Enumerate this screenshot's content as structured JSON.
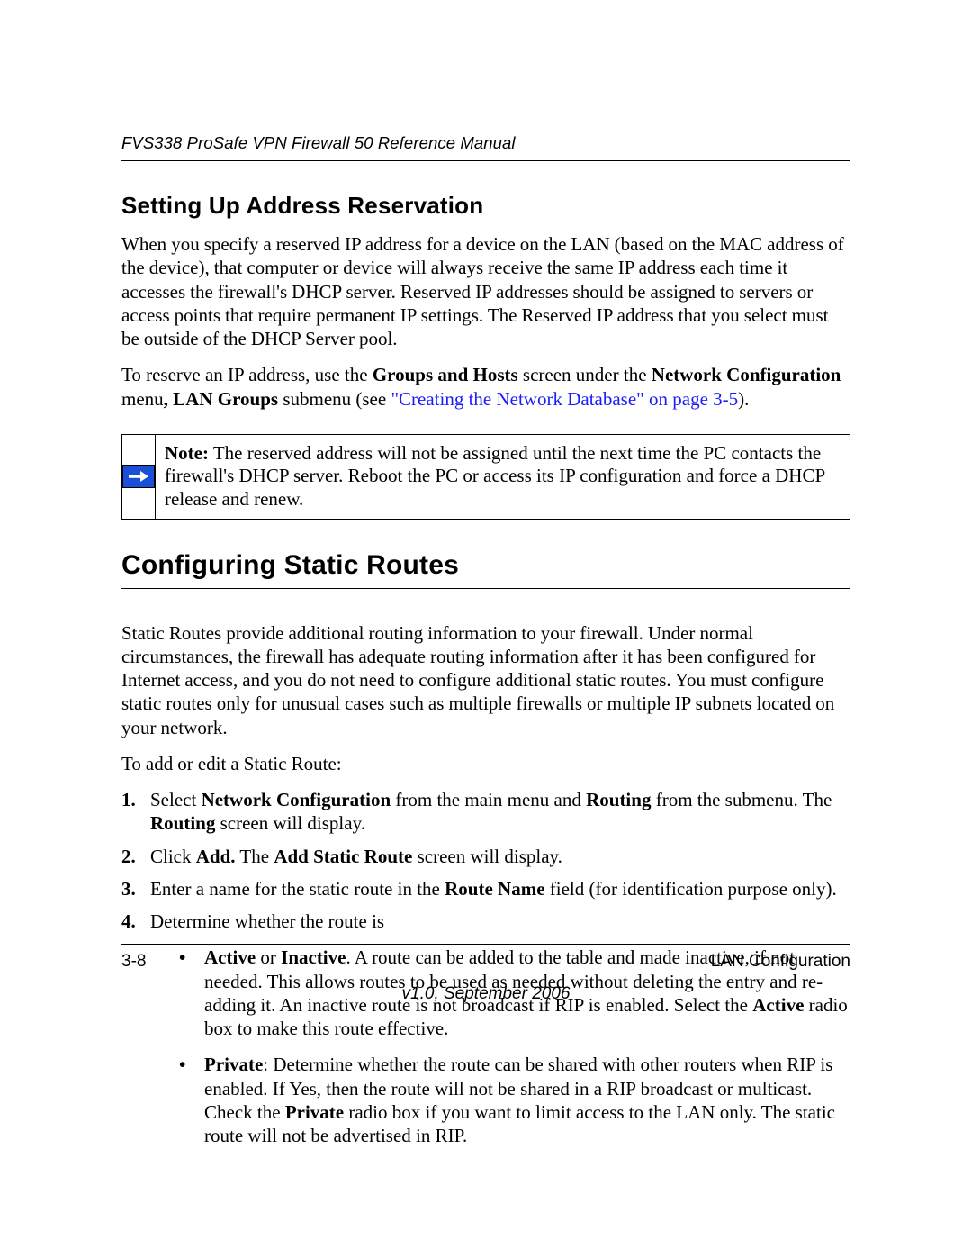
{
  "runningHead": "FVS338 ProSafe VPN Firewall 50 Reference Manual",
  "section1": {
    "title": "Setting Up Address Reservation",
    "p1": "When you specify a reserved IP address for a device on the LAN (based on the MAC address of the device), that computer or device will always receive the same IP address each time it accesses the firewall's DHCP server. Reserved IP addresses should be assigned to servers or access points that require permanent IP settings. The Reserved IP address that you select must be outside of the DHCP Server pool.",
    "p2_a": "To reserve an IP address, use the ",
    "p2_b": "Groups and Hosts",
    "p2_c": " screen under the ",
    "p2_d": "Network Configuration",
    "p2_e": " menu",
    "p2_f": ", LAN Groups",
    "p2_g": " submenu (see ",
    "p2_link": "\"Creating the Network Database\" on page 3-5",
    "p2_h": ")."
  },
  "note": {
    "label": "Note:",
    "text": " The reserved address will not be assigned until the next time the PC contacts the firewall's DHCP server. Reboot the PC or access its IP configuration and force a DHCP release and renew."
  },
  "section2": {
    "title": "Configuring Static Routes",
    "p1": "Static Routes provide additional routing information to your firewall. Under normal circumstances, the firewall has adequate routing information after it has been configured for Internet access, and you do not need to configure additional static routes. You must configure static routes only for unusual cases such as multiple firewalls or multiple IP subnets located on your network.",
    "p2": "To add or edit a Static Route:"
  },
  "steps": {
    "s1_a": "Select ",
    "s1_b": "Network Configuration",
    "s1_c": " from the main menu and ",
    "s1_d": "Routing",
    "s1_e": " from the submenu. The ",
    "s1_f": "Routing",
    "s1_g": " screen will display.",
    "s2_a": "Click ",
    "s2_b": "Add.",
    "s2_c": " The ",
    "s2_d": "Add Static Route",
    "s2_e": " screen will display.",
    "s3_a": "Enter a name for the static route in the ",
    "s3_b": "Route Name",
    "s3_c": " field (for identification purpose only).",
    "s4": "Determine whether the route is"
  },
  "bullets": {
    "b1_a": "Active",
    "b1_b": " or ",
    "b1_c": "Inactive",
    "b1_d": ". A route can be added to the table and made inactive, if not needed. This allows routes to be used as needed without deleting the entry and re-adding it. An inactive route is not broadcast if RIP is enabled. Select the ",
    "b1_e": "Active",
    "b1_f": " radio box to make this route effective.",
    "b2_a": "Private",
    "b2_b": ": Determine whether the route can be shared with other routers when RIP is enabled. If Yes, then the route will not be shared in a RIP broadcast or multicast. Check the ",
    "b2_c": "Private",
    "b2_d": " radio box if you want to limit access to the LAN only. The static route will not be advertised in RIP."
  },
  "footer": {
    "pageNum": "3-8",
    "chapter": "LAN Configuration",
    "version": "v1.0, September 2006"
  },
  "nums": {
    "n1": "1.",
    "n2": "2.",
    "n3": "3.",
    "n4": "4."
  }
}
